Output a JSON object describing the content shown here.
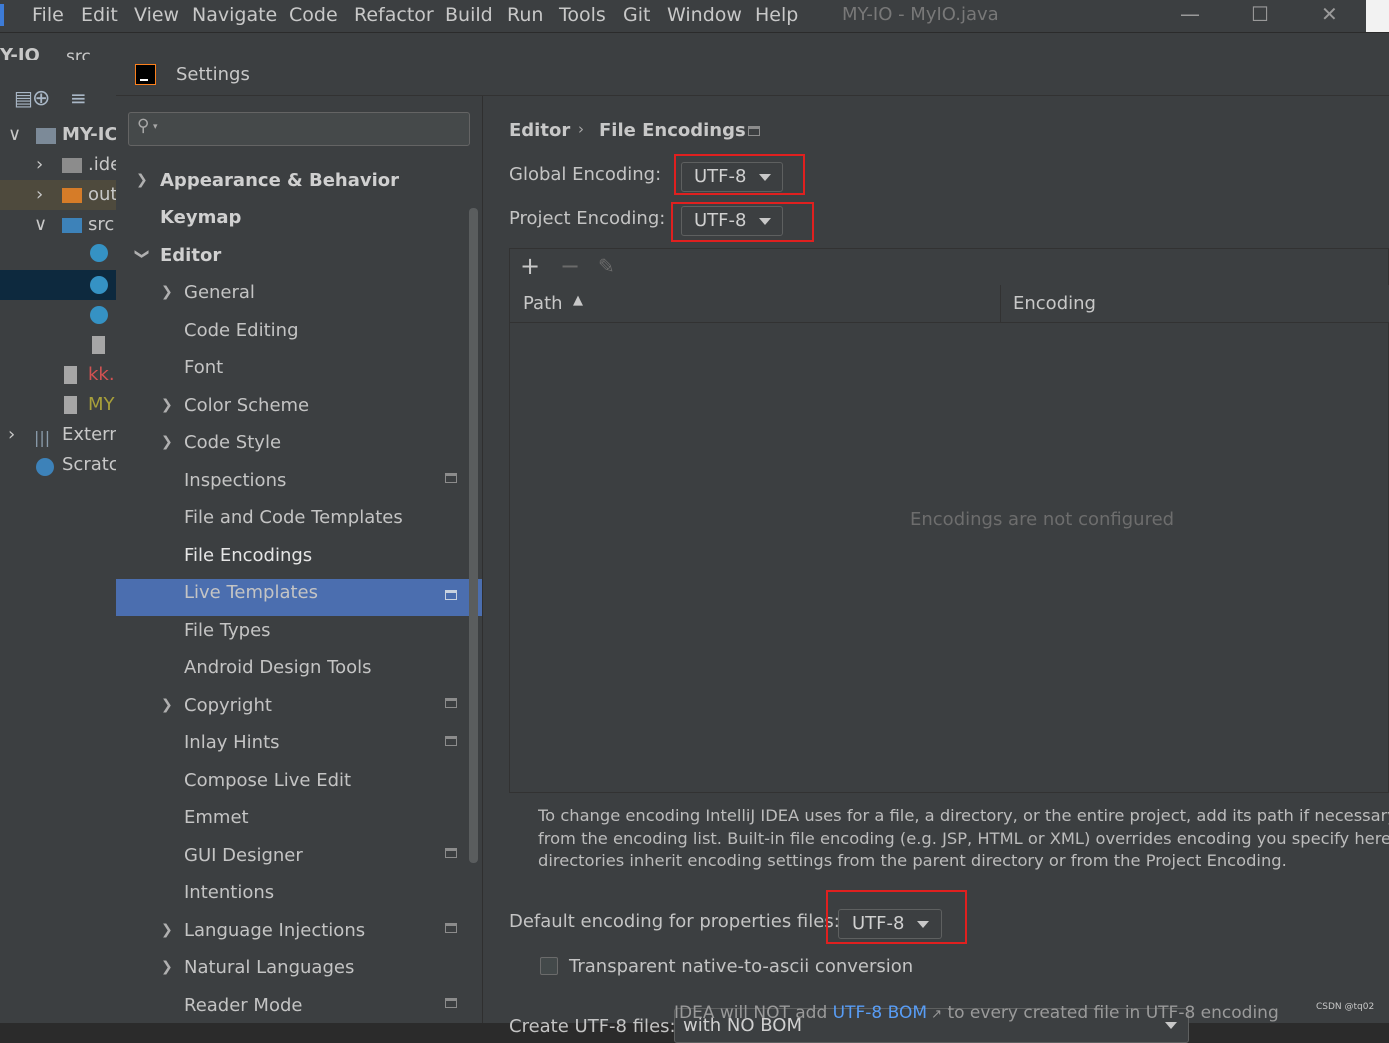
{
  "ide": {
    "menu": [
      "File",
      "Edit",
      "View",
      "Navigate",
      "Code",
      "Refactor",
      "Build",
      "Run",
      "Tools",
      "Git",
      "Window",
      "Help"
    ],
    "window_title": "MY-IO - MyIO.java",
    "breadcrumb": [
      "Y-IO",
      "src"
    ],
    "project_tree": [
      "MY-IC",
      ".ide",
      "out",
      "src",
      "kk.",
      "MY",
      "Extern",
      "Scratc"
    ]
  },
  "dialog": {
    "title": "Settings",
    "search_placeholder": "",
    "tree": {
      "appearance": "Appearance & Behavior",
      "keymap": "Keymap",
      "editor": "Editor",
      "items": [
        "General",
        "Code Editing",
        "Font",
        "Color Scheme",
        "Code Style",
        "Inspections",
        "File and Code Templates",
        "File Encodings",
        "Live Templates",
        "File Types",
        "Android Design Tools",
        "Copyright",
        "Inlay Hints",
        "Compose Live Edit",
        "Emmet",
        "GUI Designer",
        "Intentions",
        "Language Injections",
        "Natural Languages",
        "Reader Mode"
      ],
      "selected": "File Encodings"
    },
    "breadcrumb": {
      "parent": "Editor",
      "current": "File Encodings"
    },
    "global_encoding": {
      "label": "Global Encoding:",
      "value": "UTF-8"
    },
    "project_encoding": {
      "label": "Project Encoding:",
      "value": "UTF-8"
    },
    "table": {
      "col_path": "Path",
      "col_encoding": "Encoding",
      "empty": "Encodings are not configured"
    },
    "help_text": {
      "line1": "To change encoding IntelliJ IDEA uses for a file, a directory, or the entire project, add its path if necessary and t",
      "line2": "from the encoding list. Built-in file encoding (e.g. JSP, HTML or XML) overrides encoding you specify here. If not",
      "line3": "directories inherit encoding settings from the parent directory or from the Project Encoding."
    },
    "properties_encoding": {
      "label": "Default encoding for properties files:",
      "value": "UTF-8"
    },
    "native_ascii": {
      "label": "Transparent native-to-ascii conversion",
      "checked": false
    },
    "create_utf8": {
      "label": "Create UTF-8 files:",
      "value": "with NO BOM"
    },
    "bom_note": {
      "pre": "IDEA will NOT add ",
      "link": "UTF-8 BOM",
      "post": " to every created file in UTF-8 encoding"
    }
  },
  "watermark": "CSDN @tq02"
}
